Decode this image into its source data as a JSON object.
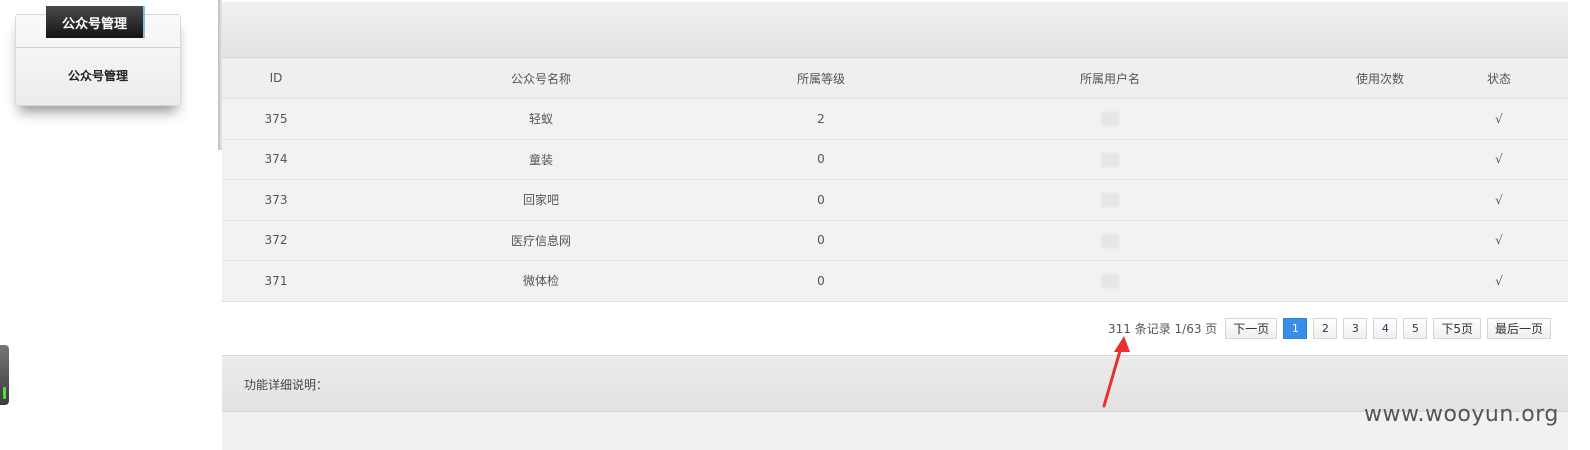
{
  "sidebar": {
    "title": "公众号管理",
    "items": [
      {
        "label": "公众号管理"
      }
    ]
  },
  "table": {
    "headers": [
      "ID",
      "公众号名称",
      "所属等级",
      "所属用户名",
      "使用次数",
      "状态"
    ],
    "rows": [
      {
        "id": "375",
        "name": "轻蚁",
        "level": "2",
        "username": "",
        "count": "",
        "status": "√"
      },
      {
        "id": "374",
        "name": "童装",
        "level": "0",
        "username": "",
        "count": "",
        "status": "√"
      },
      {
        "id": "373",
        "name": "回家吧",
        "level": "0",
        "username": "",
        "count": "",
        "status": "√"
      },
      {
        "id": "372",
        "name": "医疗信息网",
        "level": "0",
        "username": "",
        "count": "",
        "status": "√"
      },
      {
        "id": "371",
        "name": "微体检",
        "level": "0",
        "username": "",
        "count": "",
        "status": "√"
      }
    ]
  },
  "pager": {
    "info": "311 条记录 1/63 页",
    "next": "下一页",
    "pages": [
      "1",
      "2",
      "3",
      "4",
      "5"
    ],
    "active_page": "1",
    "next5": "下5页",
    "last": "最后一页"
  },
  "description": {
    "label": "功能详细说明："
  },
  "watermark": "www.wooyun.org",
  "colors": {
    "active_page": "#3b8ee8",
    "check": "#2244cc",
    "arrow": "#e83030",
    "sidebar_title_bg": "#1e1e1e"
  },
  "icons": {
    "float_toggle": "sidebar-toggle-icon",
    "arrow": "red-arrow-annotation"
  }
}
